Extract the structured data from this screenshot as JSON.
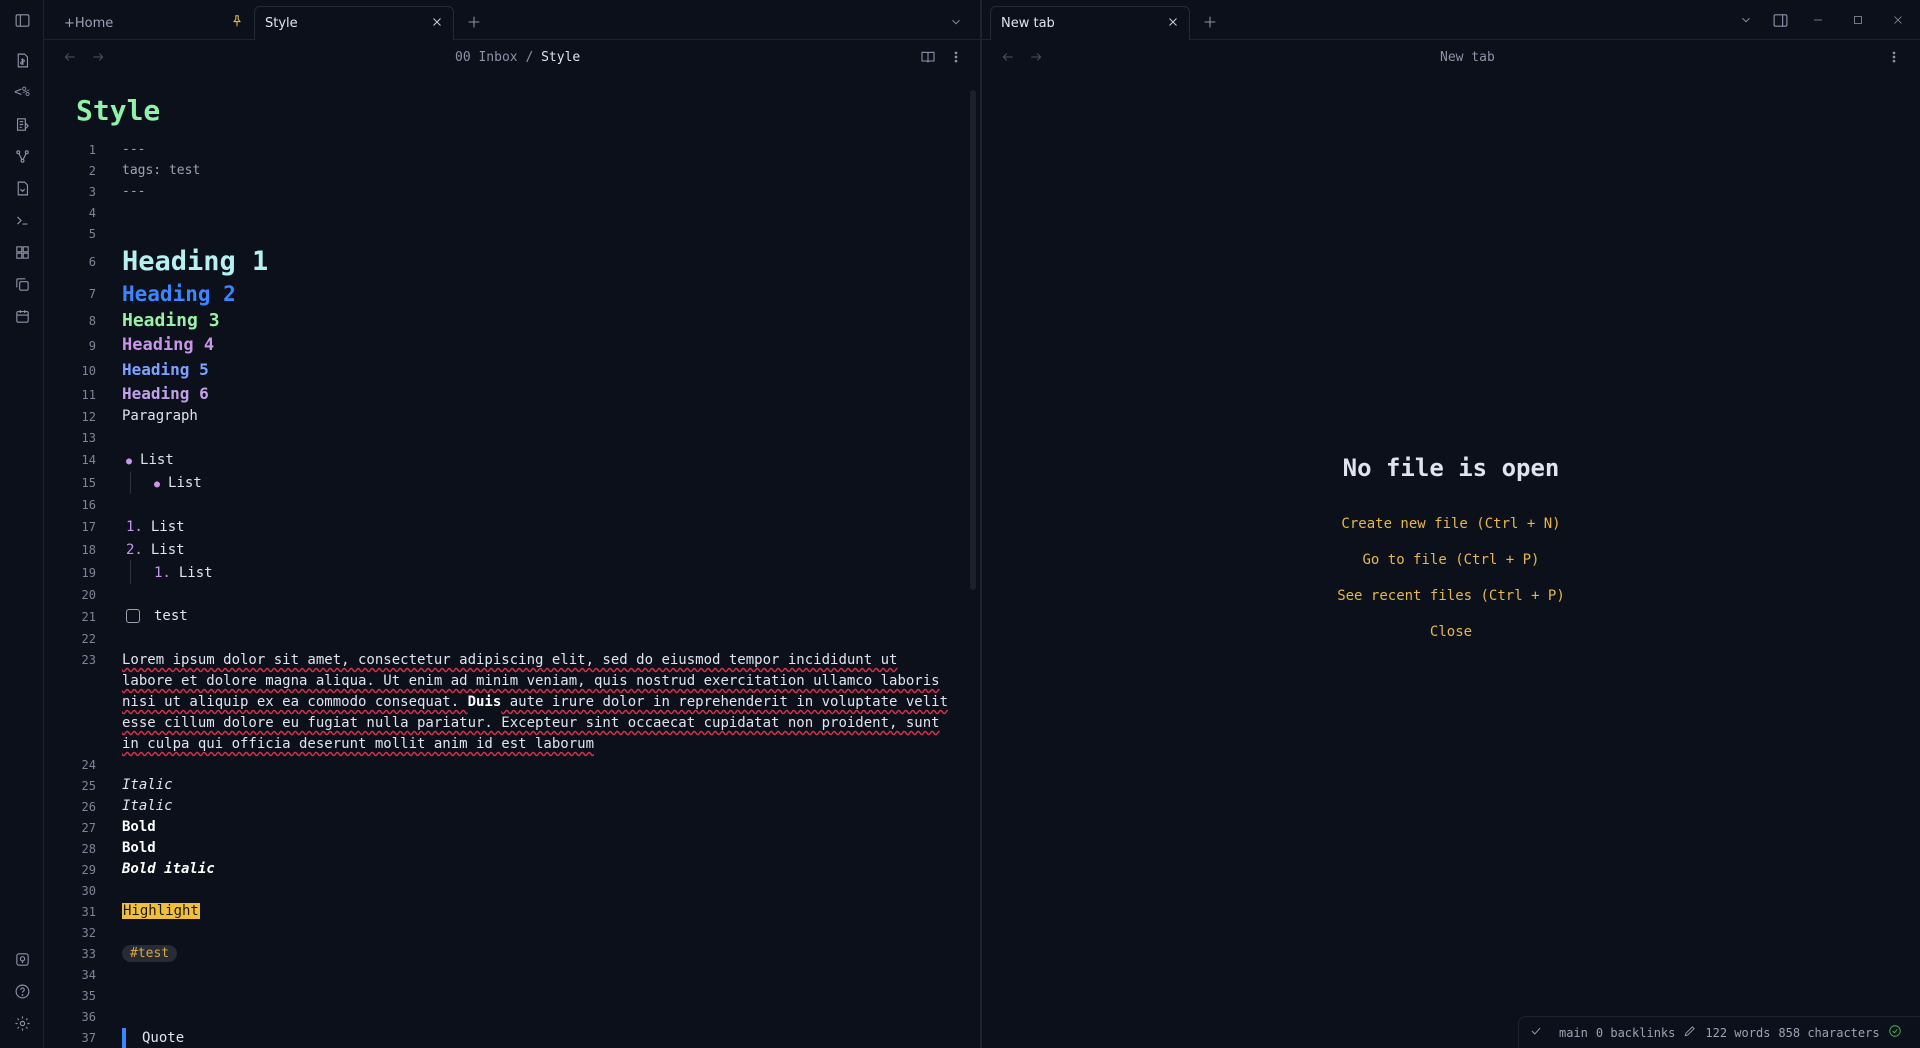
{
  "left_tabs": [
    {
      "label": "+Home",
      "pinned": true,
      "active": false
    },
    {
      "label": "Style",
      "active": true
    }
  ],
  "right_tabs": [
    {
      "label": "New tab",
      "active": true
    }
  ],
  "left_pane": {
    "breadcrumb_folder": "00 Inbox",
    "breadcrumb_sep": "/",
    "breadcrumb_file": "Style",
    "title": "Style",
    "frontmatter": [
      "---",
      "tags: test",
      "---"
    ],
    "headings": [
      "Heading 1",
      "Heading 2",
      "Heading 3",
      "Heading 4",
      "Heading 5",
      "Heading 6"
    ],
    "paragraph": "Paragraph",
    "bullets": [
      "List",
      "List"
    ],
    "numbered": [
      {
        "n": "1.",
        "text": "List"
      },
      {
        "n": "2.",
        "text": "List"
      },
      {
        "n": "1.",
        "text": "List"
      }
    ],
    "task": "test",
    "lorem_parts": {
      "p1": "Lorem ipsum dolor sit amet, consectetur adipiscing elit, sed do eiusmod tempor incididunt ut labore et dolore magna aliqua. Ut enim ad minim veniam, quis nostrud exercitation ullamco laboris nisi ut aliquip ex ea commodo consequat. ",
      "bold": "Duis",
      "p2": " aute irure dolor in reprehenderit in voluptate velit esse cillum dolore eu fugiat nulla pariatur. Excepteur sint occaecat cupidatat non proident, sunt in culpa qui officia deserunt mollit anim id est laborum"
    },
    "italic1": "Italic",
    "italic2": "Italic",
    "bold1": "Bold",
    "bold2": "Bold",
    "bold_italic": "Bold italic",
    "highlight": "Highlight",
    "tag": "#test",
    "quote": "Quote",
    "line_numbers": [
      "1",
      "2",
      "3",
      "4",
      "5",
      "6",
      "7",
      "8",
      "9",
      "10",
      "11",
      "12",
      "13",
      "14",
      "15",
      "16",
      "17",
      "18",
      "19",
      "20",
      "21",
      "22",
      "23",
      "24",
      "25",
      "26",
      "27",
      "28",
      "29",
      "30",
      "31",
      "32",
      "33",
      "34",
      "35",
      "36",
      "37"
    ]
  },
  "right_pane": {
    "title": "New tab",
    "empty_title": "No file is open",
    "actions": [
      "Create new file (Ctrl + N)",
      "Go to file (Ctrl + P)",
      "See recent files (Ctrl + P)",
      "Close"
    ]
  },
  "status_bar": {
    "branch": "main",
    "backlinks": "0 backlinks",
    "words": "122 words",
    "chars": "858 characters"
  },
  "colors": {
    "accent": "#e6b84a",
    "title": "#8ef2a8",
    "background": "#0b101b"
  }
}
